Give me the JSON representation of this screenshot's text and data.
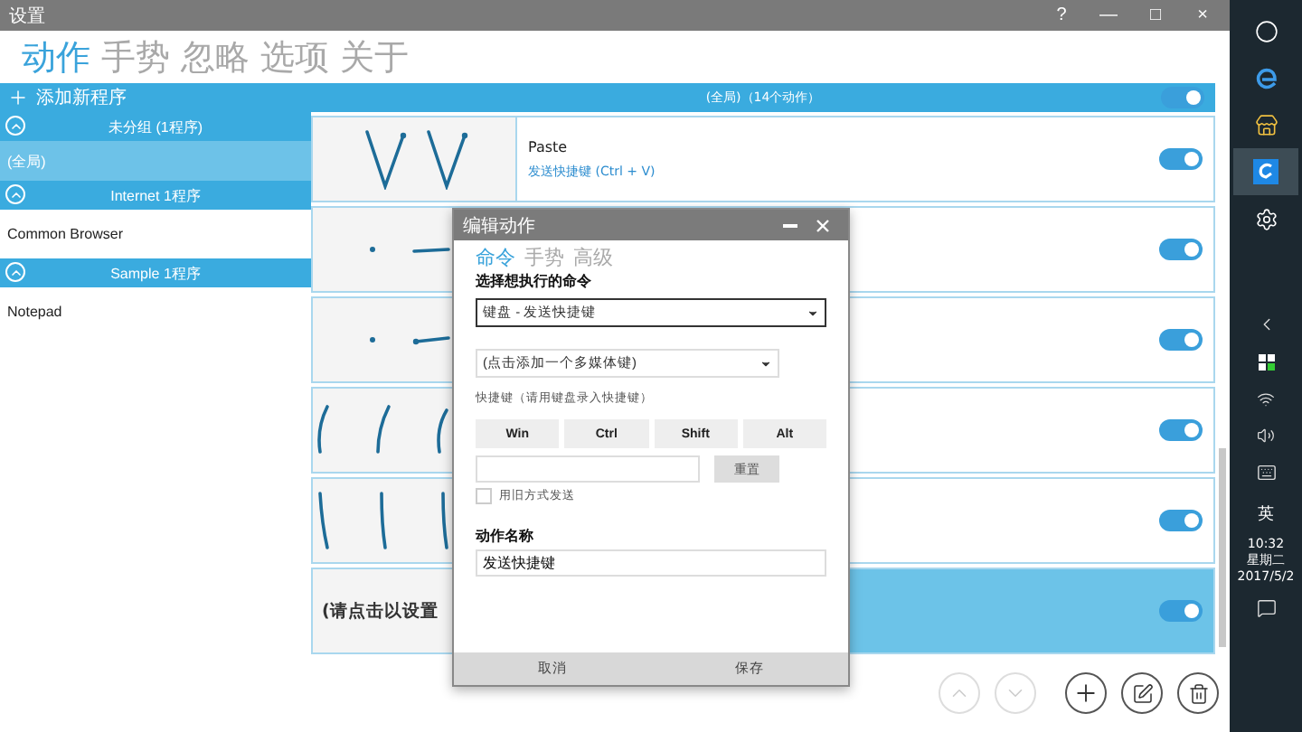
{
  "window": {
    "title": "设置",
    "controls": [
      "?",
      "—",
      "□",
      "×"
    ]
  },
  "tabs": [
    {
      "label": "动作",
      "selected": true
    },
    {
      "label": "手势",
      "selected": false
    },
    {
      "label": "忽略",
      "selected": false
    },
    {
      "label": "选项",
      "selected": false
    },
    {
      "label": "关于",
      "selected": false
    }
  ],
  "sidebar": {
    "add_label": "添加新程序",
    "groups": [
      {
        "label": "未分组 (1程序)",
        "expanded": true,
        "items": [
          {
            "label": "(全局)",
            "selected": true
          }
        ]
      },
      {
        "label": "Internet 1程序",
        "expanded": true,
        "items": [
          {
            "label": "Common Browser",
            "selected": false
          }
        ]
      },
      {
        "label": "Sample 1程序",
        "expanded": true,
        "items": [
          {
            "label": "Notepad",
            "selected": false
          }
        ]
      }
    ]
  },
  "actions": {
    "header": "(全局)（14个动作）",
    "header_on": true,
    "rows": [
      {
        "kind": "double-v",
        "title": "Paste",
        "command": "发送快捷键 (Ctrl + V)",
        "on": true,
        "selected": false
      },
      {
        "kind": "dot-line-right",
        "on": true,
        "selected": false
      },
      {
        "kind": "dot-arrow-left",
        "on": true,
        "selected": false
      },
      {
        "kind": "curves-up",
        "on": true,
        "selected": false
      },
      {
        "kind": "lines-down",
        "on": true,
        "selected": false
      },
      {
        "kind": "prompt",
        "prompt": "(请点击以设置",
        "on": true,
        "selected": true
      }
    ]
  },
  "toolbar": [
    {
      "kind": "up",
      "disabled": true
    },
    {
      "kind": "down",
      "disabled": true
    },
    {
      "kind": "add",
      "disabled": false
    },
    {
      "kind": "edit",
      "disabled": false
    },
    {
      "kind": "delete",
      "disabled": false
    }
  ],
  "dialog": {
    "title": "编辑动作",
    "tabs": [
      {
        "label": "命令",
        "selected": true
      },
      {
        "label": "手势",
        "selected": false
      },
      {
        "label": "高级",
        "selected": false
      }
    ],
    "command_label": "选择想执行的命令",
    "command_value": "键盘 - 发送快捷键",
    "media_value": "(点击添加一个多媒体键)",
    "hotkey_hint": "快捷键（请用键盘录入快捷键）",
    "modifier_keys": [
      "Win",
      "Ctrl",
      "Shift",
      "Alt"
    ],
    "reset_label": "重置",
    "legacy_send": {
      "label": "用旧方式发送",
      "checked": false
    },
    "name_label": "动作名称",
    "name_value": "发送快捷键",
    "buttons": [
      "取消",
      "保存"
    ]
  },
  "taskbar": {
    "apps": [
      {
        "kind": "cortana",
        "selected": false
      },
      {
        "kind": "edge",
        "selected": false
      },
      {
        "kind": "store",
        "selected": false
      },
      {
        "kind": "gesture-app",
        "selected": true
      },
      {
        "kind": "settings",
        "selected": false
      }
    ],
    "ime": "英",
    "time": "10:32",
    "weekday": "星期二",
    "date": "2017/5/2"
  }
}
